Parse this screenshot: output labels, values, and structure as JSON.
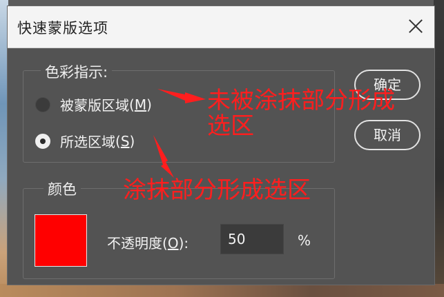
{
  "dialog": {
    "title": "快速蒙版选项",
    "color_indicates": {
      "legend": "色彩指示:",
      "options": [
        {
          "label": "被蒙版区域",
          "shortcut": "M",
          "checked": false
        },
        {
          "label": "所选区域",
          "shortcut": "S",
          "checked": true
        }
      ]
    },
    "color": {
      "legend": "颜色",
      "swatch_color": "#ff0000",
      "opacity_label": "不透明度",
      "opacity_shortcut": "O",
      "opacity_value": "50",
      "opacity_unit": "%"
    },
    "buttons": {
      "ok": "确定",
      "cancel": "取消"
    }
  },
  "annotations": {
    "note1_line1": "未被涂抹部分形成",
    "note1_line2": "选区",
    "note2": "涂抹部分形成选区",
    "color": "#ff1e1e"
  }
}
